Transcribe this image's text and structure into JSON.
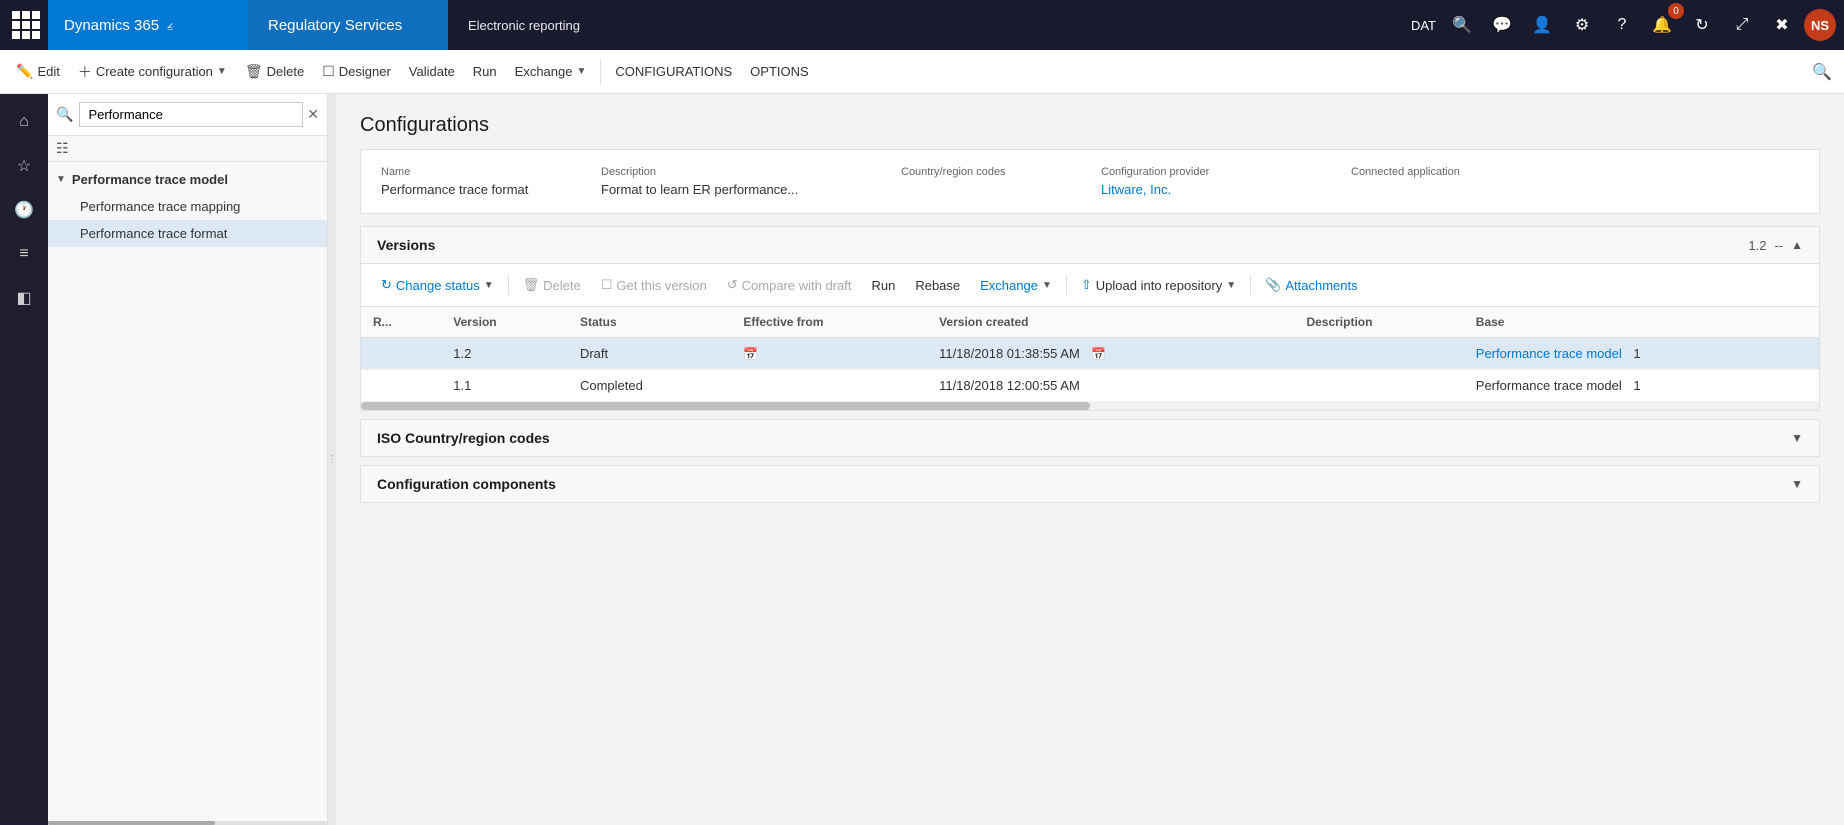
{
  "topNav": {
    "dynamics365": "Dynamics 365",
    "regulatoryServices": "Regulatory Services",
    "moduleTitle": "Electronic reporting",
    "datLabel": "DAT",
    "userInitials": "NS"
  },
  "commandBar": {
    "editLabel": "Edit",
    "createConfigLabel": "Create configuration",
    "deleteLabel": "Delete",
    "designerLabel": "Designer",
    "validateLabel": "Validate",
    "runLabel": "Run",
    "exchangeLabel": "Exchange",
    "configurationsLabel": "CONFIGURATIONS",
    "optionsLabel": "OPTIONS"
  },
  "treePanel": {
    "searchPlaceholder": "Performance",
    "items": [
      {
        "label": "Performance trace model",
        "type": "parent",
        "expanded": true
      },
      {
        "label": "Performance trace mapping",
        "type": "child"
      },
      {
        "label": "Performance trace format",
        "type": "child",
        "selected": true
      }
    ]
  },
  "configDetail": {
    "pageTitle": "Configurations",
    "columns": {
      "name": "Name",
      "description": "Description",
      "countryRegionCodes": "Country/region codes",
      "configurationProvider": "Configuration provider",
      "connectedApplication": "Connected application"
    },
    "nameValue": "Performance trace format",
    "descriptionValue": "Format to learn ER performance...",
    "countryRegionCodesValue": "",
    "configurationProviderValue": "Litware, Inc.",
    "connectedApplicationValue": ""
  },
  "versions": {
    "sectionTitle": "Versions",
    "versionBadge": "1.2",
    "separator": "--",
    "toolbar": {
      "changeStatus": "Change status",
      "delete": "Delete",
      "getThisVersion": "Get this version",
      "compareWithDraft": "Compare with draft",
      "run": "Run",
      "rebase": "Rebase",
      "exchange": "Exchange",
      "uploadIntoRepository": "Upload into repository",
      "attachments": "Attachments"
    },
    "tableHeaders": {
      "r": "R...",
      "version": "Version",
      "status": "Status",
      "effectiveFrom": "Effective from",
      "versionCreated": "Version created",
      "description": "Description",
      "base": "Base"
    },
    "rows": [
      {
        "r": "",
        "version": "1.2",
        "status": "Draft",
        "effectiveFrom": "",
        "versionCreated": "11/18/2018 01:38:55 AM",
        "description": "",
        "base": "Performance trace model",
        "baseVersion": "1",
        "selected": true
      },
      {
        "r": "",
        "version": "1.1",
        "status": "Completed",
        "effectiveFrom": "",
        "versionCreated": "11/18/2018 12:00:55 AM",
        "description": "",
        "base": "Performance trace model",
        "baseVersion": "1",
        "selected": false
      }
    ]
  },
  "isoSection": {
    "title": "ISO Country/region codes"
  },
  "configComponentsSection": {
    "title": "Configuration components"
  }
}
